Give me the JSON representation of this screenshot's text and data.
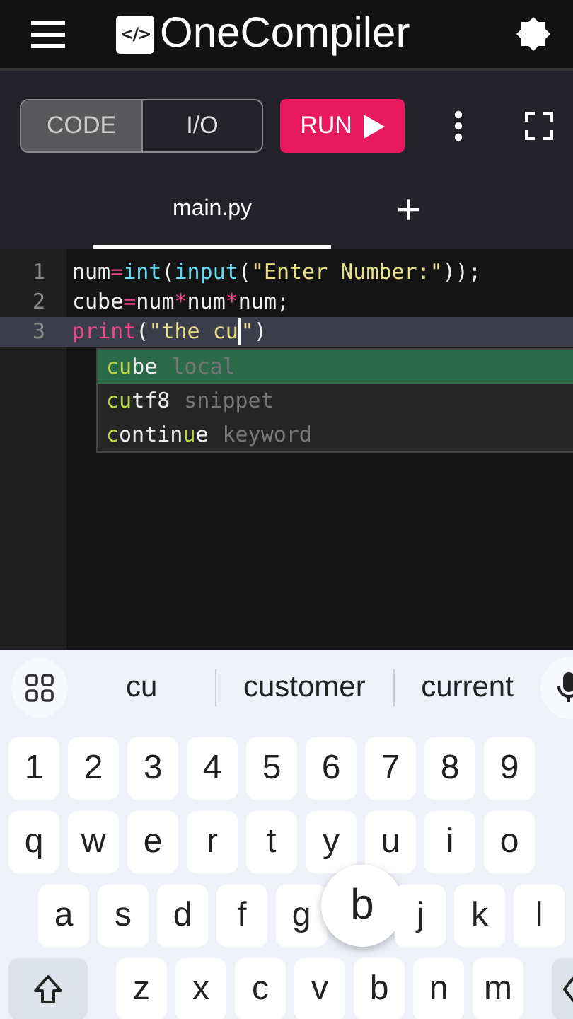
{
  "header": {
    "logo_mark": "</>",
    "title": "OneCompiler"
  },
  "toolbar": {
    "modes": [
      {
        "label": "CODE",
        "selected": true
      },
      {
        "label": "I/O",
        "selected": false
      }
    ],
    "run": "RUN"
  },
  "tabs": [
    {
      "label": "main.py",
      "selected": true
    }
  ],
  "tab_add": "+",
  "editor": {
    "lines": [
      {
        "number": "1",
        "current": false,
        "tokens": [
          {
            "kind": "plain",
            "text": "num"
          },
          {
            "kind": "operator",
            "text": "="
          },
          {
            "kind": "builtin",
            "text": "int"
          },
          {
            "kind": "plain",
            "text": "("
          },
          {
            "kind": "builtin",
            "text": "input"
          },
          {
            "kind": "plain",
            "text": "("
          },
          {
            "kind": "string",
            "text": "\"Enter Number:\""
          },
          {
            "kind": "plain",
            "text": "));"
          }
        ]
      },
      {
        "number": "2",
        "current": false,
        "tokens": [
          {
            "kind": "plain",
            "text": "cube"
          },
          {
            "kind": "operator",
            "text": "="
          },
          {
            "kind": "plain",
            "text": "num"
          },
          {
            "kind": "operator",
            "text": "*"
          },
          {
            "kind": "plain",
            "text": "num"
          },
          {
            "kind": "operator",
            "text": "*"
          },
          {
            "kind": "plain",
            "text": "num;"
          }
        ]
      },
      {
        "number": "3",
        "current": true,
        "tokens": [
          {
            "kind": "keyword",
            "text": "print"
          },
          {
            "kind": "plain",
            "text": "("
          },
          {
            "kind": "string",
            "text": "\"the cu"
          },
          {
            "kind": "cursor"
          },
          {
            "kind": "string",
            "text": "\""
          },
          {
            "kind": "plain",
            "text": ")"
          }
        ]
      }
    ],
    "suggestions": [
      {
        "selected": true,
        "type": "local",
        "parts": [
          {
            "text": "cu",
            "match": true
          },
          {
            "text": "be",
            "match": false
          }
        ]
      },
      {
        "selected": false,
        "type": "snippet",
        "parts": [
          {
            "text": "cu",
            "match": true
          },
          {
            "text": "tf8",
            "match": false
          }
        ]
      },
      {
        "selected": false,
        "type": "keyword",
        "parts": [
          {
            "text": "c",
            "match": true
          },
          {
            "text": "ontin",
            "match": false
          },
          {
            "text": "u",
            "match": true
          },
          {
            "text": "e",
            "match": false
          }
        ]
      }
    ]
  },
  "keyboard": {
    "suggestions": [
      "cu",
      "customer",
      "current"
    ],
    "rows": [
      [
        {
          "kind": "char",
          "label": "1"
        },
        {
          "kind": "char",
          "label": "2"
        },
        {
          "kind": "char",
          "label": "3"
        },
        {
          "kind": "char",
          "label": "4"
        },
        {
          "kind": "char",
          "label": "5"
        },
        {
          "kind": "char",
          "label": "6"
        },
        {
          "kind": "char",
          "label": "7"
        },
        {
          "kind": "char",
          "label": "8"
        },
        {
          "kind": "char",
          "label": "9"
        }
      ],
      [
        {
          "kind": "char",
          "label": "q"
        },
        {
          "kind": "char",
          "label": "w"
        },
        {
          "kind": "char",
          "label": "e"
        },
        {
          "kind": "char",
          "label": "r"
        },
        {
          "kind": "char",
          "label": "t"
        },
        {
          "kind": "char",
          "label": "y"
        },
        {
          "kind": "char",
          "label": "u"
        },
        {
          "kind": "char",
          "label": "i"
        },
        {
          "kind": "char",
          "label": "o"
        }
      ],
      [
        {
          "kind": "char",
          "label": "a"
        },
        {
          "kind": "char",
          "label": "s"
        },
        {
          "kind": "char",
          "label": "d"
        },
        {
          "kind": "char",
          "label": "f"
        },
        {
          "kind": "char",
          "label": "g"
        },
        {
          "kind": "preview",
          "label": "b"
        },
        {
          "kind": "char",
          "label": "j"
        },
        {
          "kind": "char",
          "label": "k"
        },
        {
          "kind": "char",
          "label": "l"
        }
      ],
      [
        {
          "kind": "shift"
        },
        {
          "kind": "char",
          "label": "z"
        },
        {
          "kind": "char",
          "label": "x"
        },
        {
          "kind": "char",
          "label": "c"
        },
        {
          "kind": "char",
          "label": "v"
        },
        {
          "kind": "char",
          "label": "b"
        },
        {
          "kind": "char",
          "label": "n"
        },
        {
          "kind": "char",
          "label": "m"
        },
        {
          "kind": "backspace"
        }
      ]
    ]
  }
}
